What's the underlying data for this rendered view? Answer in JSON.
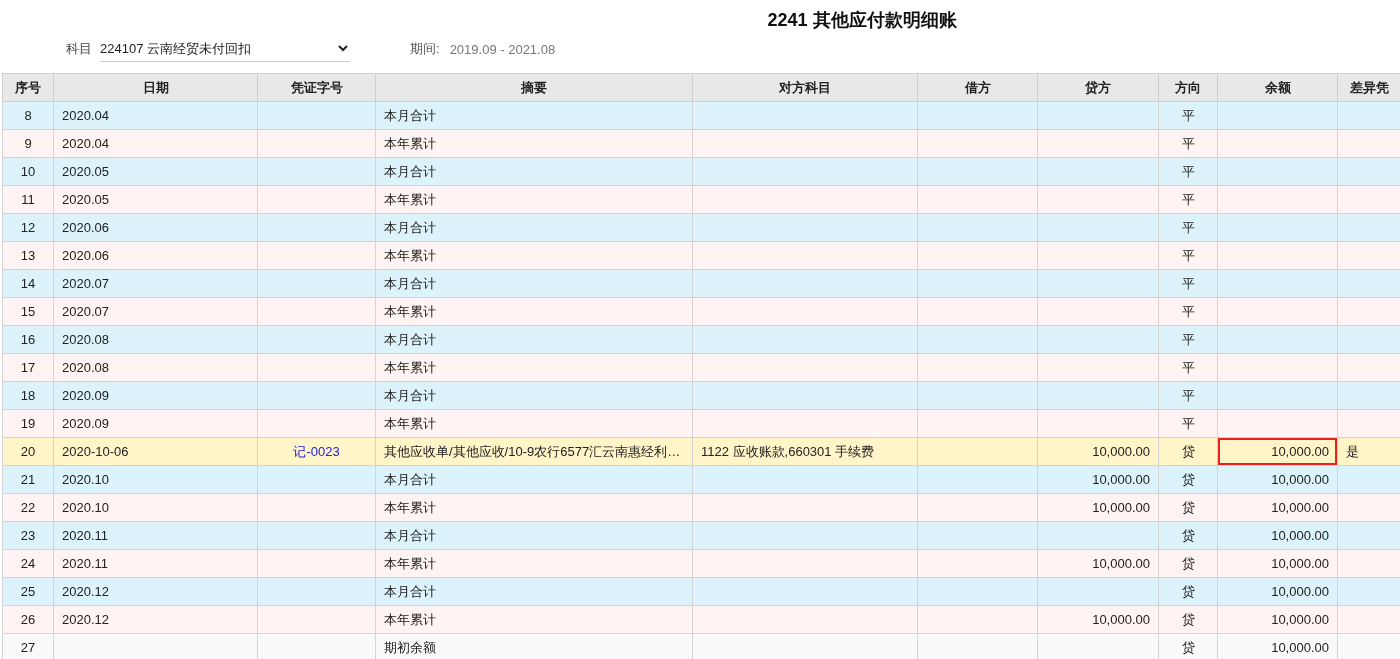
{
  "title": "2241 其他应付款明细账",
  "filters": {
    "subject_label": "科目",
    "subject_value": "224107 云南经贸未付回扣",
    "period_label": "期间:",
    "period_value": "2019.09 - 2021.08"
  },
  "table": {
    "columns": [
      "序号",
      "日期",
      "凭证字号",
      "摘要",
      "对方科目",
      "借方",
      "贷方",
      "方向",
      "余额",
      "差异凭"
    ],
    "rows": [
      {
        "kind": "month",
        "flagged": false,
        "seq": "8",
        "date": "2020.04",
        "summary": "本月合计",
        "direction": "平"
      },
      {
        "kind": "year",
        "flagged": false,
        "seq": "9",
        "date": "2020.04",
        "summary": "本年累计",
        "direction": "平"
      },
      {
        "kind": "month",
        "flagged": false,
        "seq": "10",
        "date": "2020.05",
        "summary": "本月合计",
        "direction": "平"
      },
      {
        "kind": "year",
        "flagged": false,
        "seq": "11",
        "date": "2020.05",
        "summary": "本年累计",
        "direction": "平"
      },
      {
        "kind": "month",
        "flagged": false,
        "seq": "12",
        "date": "2020.06",
        "summary": "本月合计",
        "direction": "平"
      },
      {
        "kind": "year",
        "flagged": false,
        "seq": "13",
        "date": "2020.06",
        "summary": "本年累计",
        "direction": "平"
      },
      {
        "kind": "month",
        "flagged": false,
        "seq": "14",
        "date": "2020.07",
        "summary": "本月合计",
        "direction": "平"
      },
      {
        "kind": "year",
        "flagged": false,
        "seq": "15",
        "date": "2020.07",
        "summary": "本年累计",
        "direction": "平"
      },
      {
        "kind": "month",
        "flagged": false,
        "seq": "16",
        "date": "2020.08",
        "summary": "本月合计",
        "direction": "平"
      },
      {
        "kind": "year",
        "flagged": false,
        "seq": "17",
        "date": "2020.08",
        "summary": "本年累计",
        "direction": "平"
      },
      {
        "kind": "month",
        "flagged": false,
        "seq": "18",
        "date": "2020.09",
        "summary": "本月合计",
        "direction": "平"
      },
      {
        "kind": "year",
        "flagged": false,
        "seq": "19",
        "date": "2020.09",
        "summary": "本年累计",
        "direction": "平"
      },
      {
        "kind": "entry",
        "flagged": true,
        "seq": "20",
        "date": "2020-10-06",
        "voucher": "记-0023",
        "summary": "其他应收单/其他应收/10-9农行6577汇云南惠经利…",
        "counter_account": "1122 应收账款,660301 手续费",
        "credit": "10,000.00",
        "direction": "贷",
        "balance": "10,000.00",
        "diff_voucher": "是"
      },
      {
        "kind": "month",
        "flagged": false,
        "seq": "21",
        "date": "2020.10",
        "summary": "本月合计",
        "credit": "10,000.00",
        "direction": "贷",
        "balance": "10,000.00"
      },
      {
        "kind": "year",
        "flagged": false,
        "seq": "22",
        "date": "2020.10",
        "summary": "本年累计",
        "credit": "10,000.00",
        "direction": "贷",
        "balance": "10,000.00"
      },
      {
        "kind": "month",
        "flagged": false,
        "seq": "23",
        "date": "2020.11",
        "summary": "本月合计",
        "direction": "贷",
        "balance": "10,000.00"
      },
      {
        "kind": "year",
        "flagged": false,
        "seq": "24",
        "date": "2020.11",
        "summary": "本年累计",
        "credit": "10,000.00",
        "direction": "贷",
        "balance": "10,000.00"
      },
      {
        "kind": "month",
        "flagged": false,
        "seq": "25",
        "date": "2020.12",
        "summary": "本月合计",
        "direction": "贷",
        "balance": "10,000.00"
      },
      {
        "kind": "year",
        "flagged": false,
        "seq": "26",
        "date": "2020.12",
        "summary": "本年累计",
        "credit": "10,000.00",
        "direction": "贷",
        "balance": "10,000.00"
      },
      {
        "kind": "opening",
        "flagged": false,
        "seq": "27",
        "summary": "期初余额",
        "direction": "贷",
        "balance": "10,000.00"
      }
    ]
  }
}
